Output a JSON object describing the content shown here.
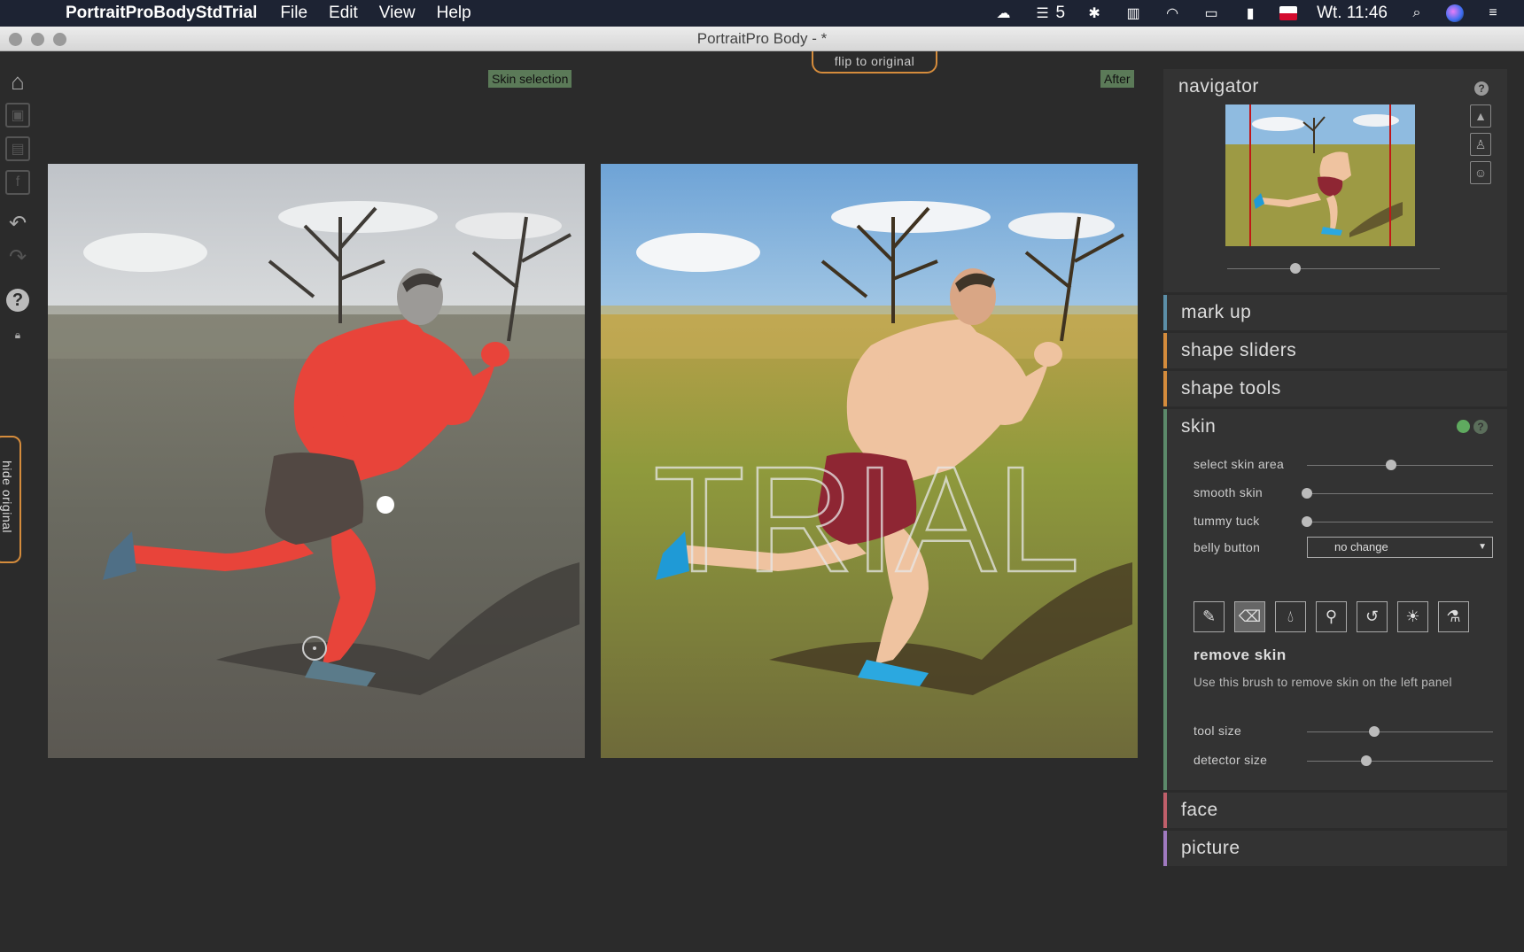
{
  "menubar": {
    "app_name": "PortraitProBodyStdTrial",
    "items": [
      "File",
      "Edit",
      "View",
      "Help"
    ],
    "badge_count": "5",
    "clock": "Wt. 11:46"
  },
  "window": {
    "title": "PortraitPro Body -  *"
  },
  "canvas": {
    "label_left": "Skin selection",
    "label_right": "After",
    "flip_button": "flip to original",
    "hide_original": "hide original",
    "watermark": "TRIAL"
  },
  "navigator": {
    "title": "navigator",
    "zoom": 0.32
  },
  "sections": {
    "mark_up": "mark up",
    "shape_sliders": "shape sliders",
    "shape_tools": "shape tools",
    "skin": "skin",
    "face": "face",
    "picture": "picture"
  },
  "skin": {
    "select_skin_area": {
      "label": "select skin area",
      "value": 0.45
    },
    "smooth_skin": {
      "label": "smooth skin",
      "value": 0.0
    },
    "tummy_tuck": {
      "label": "tummy tuck",
      "value": 0.0
    },
    "belly_button": {
      "label": "belly button",
      "value": "no change"
    },
    "tool_title": "remove skin",
    "tool_desc": "Use this brush to remove skin on the left panel",
    "tool_size": {
      "label": "tool size",
      "value": 0.36
    },
    "detector_size": {
      "label": "detector size",
      "value": 0.32
    }
  },
  "colors": {
    "accent_orange": "#d58c3c",
    "label_green": "#5b7a58",
    "skin_mask_red": "#e8443a"
  }
}
